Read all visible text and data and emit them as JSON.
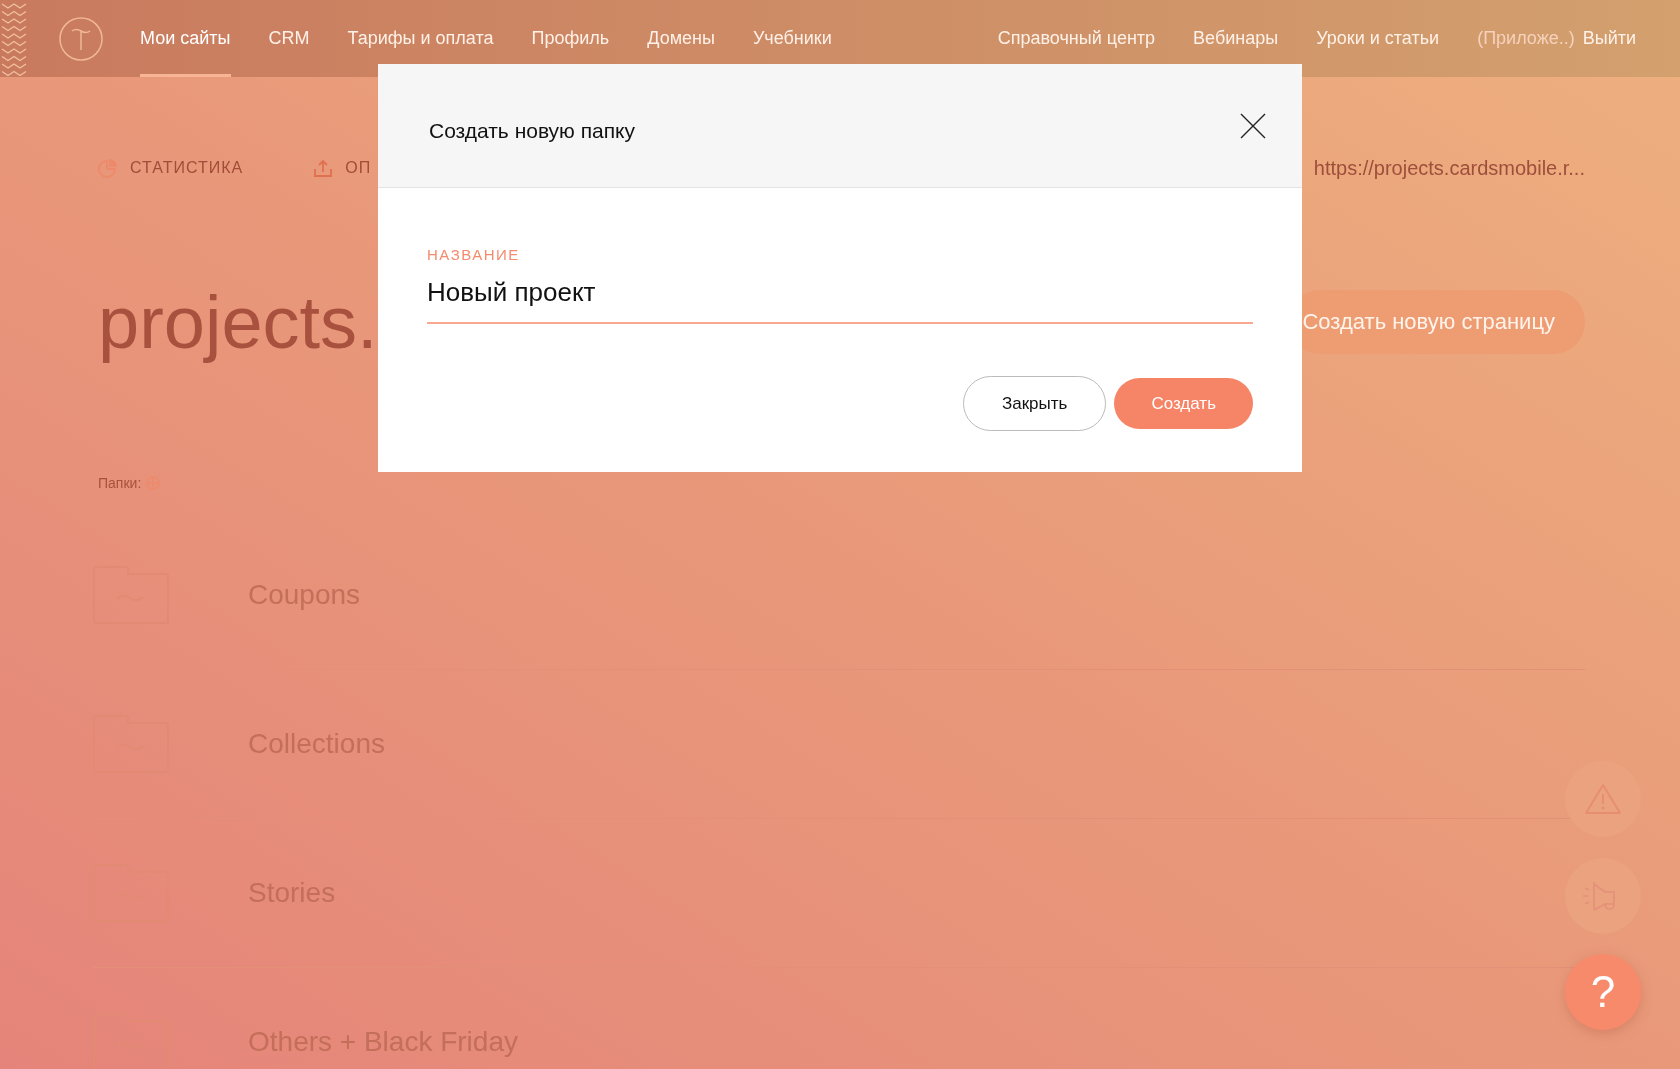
{
  "nav": {
    "left": [
      {
        "label": "Мои сайты",
        "selected": true
      },
      {
        "label": "CRM",
        "selected": false
      },
      {
        "label": "Тарифы и оплата",
        "selected": false
      },
      {
        "label": "Профиль",
        "selected": false
      },
      {
        "label": "Домены",
        "selected": false
      },
      {
        "label": "Учебники",
        "selected": false
      }
    ],
    "right": [
      {
        "label": "Справочный центр",
        "disabled": false
      },
      {
        "label": "Вебинары",
        "disabled": false
      },
      {
        "label": "Уроки и статьи",
        "disabled": false
      },
      {
        "label": "(Приложе..)",
        "disabled": true
      },
      {
        "label": "Выйти",
        "disabled": false
      }
    ]
  },
  "toolbar": {
    "statistics": "СТАТИСТИКА",
    "publish": "ОП",
    "url": "https://projects.cardsmobile.r..."
  },
  "project_title": "projects.",
  "create_page_button": "Создать новую страницу",
  "folders_label": "Папки:",
  "folders": [
    {
      "name": "Coupons"
    },
    {
      "name": "Collections"
    },
    {
      "name": "Stories"
    },
    {
      "name": "Others + Black Friday"
    }
  ],
  "dialog": {
    "title": "Создать новую папку",
    "field_label": "НАЗВАНИЕ",
    "field_value": "Новый проект",
    "buttons": [
      {
        "label": "Закрыть",
        "kind": "secondary"
      },
      {
        "label": "Создать",
        "kind": "primary"
      }
    ]
  },
  "help_button": "?"
}
